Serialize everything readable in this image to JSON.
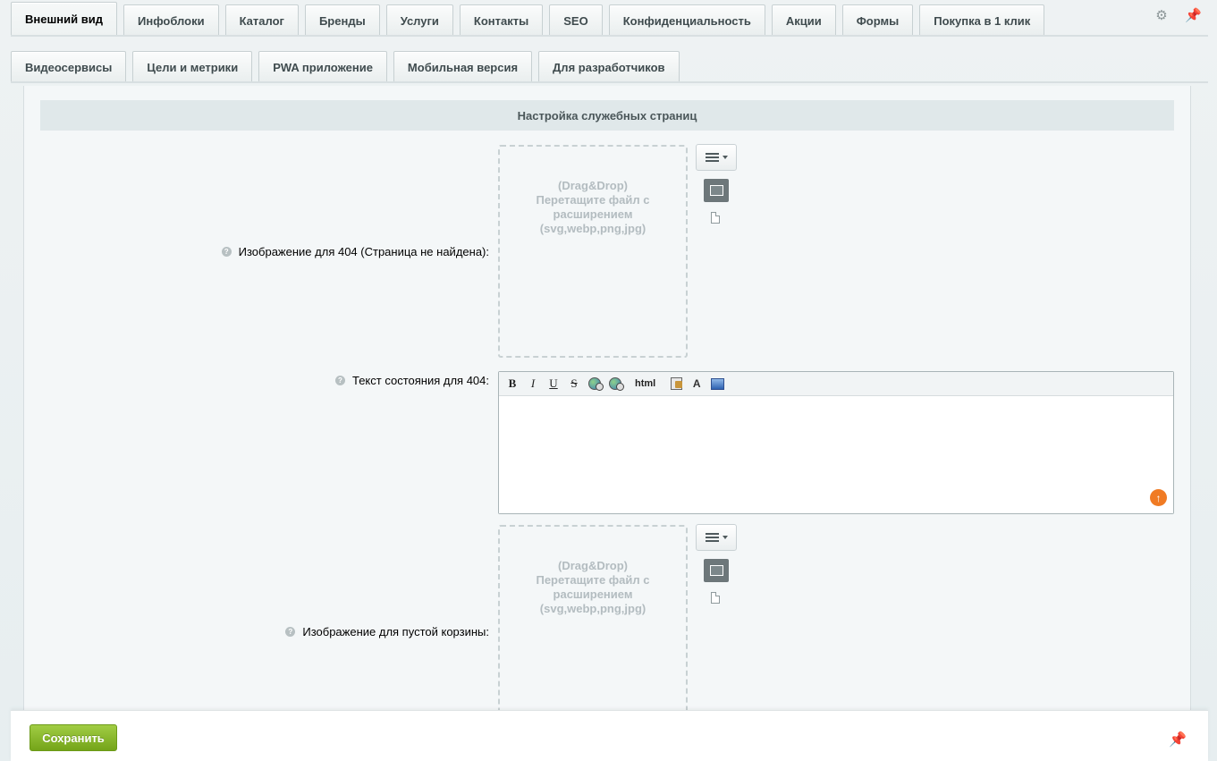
{
  "tabs_row1": [
    {
      "label": "Внешний вид",
      "active": true
    },
    {
      "label": "Инфоблоки",
      "active": false
    },
    {
      "label": "Каталог",
      "active": false
    },
    {
      "label": "Бренды",
      "active": false
    },
    {
      "label": "Услуги",
      "active": false
    },
    {
      "label": "Контакты",
      "active": false
    },
    {
      "label": "SEO",
      "active": false
    },
    {
      "label": "Конфиденциальность",
      "active": false
    },
    {
      "label": "Акции",
      "active": false
    },
    {
      "label": "Формы",
      "active": false
    },
    {
      "label": "Покупка в 1 клик",
      "active": false
    }
  ],
  "tabs_row2": [
    {
      "label": "Видеосервисы"
    },
    {
      "label": "Цели и метрики"
    },
    {
      "label": "PWA приложение"
    },
    {
      "label": "Мобильная версия"
    },
    {
      "label": "Для разработчиков"
    }
  ],
  "section": {
    "title": "Настройка служебных страниц"
  },
  "fields": {
    "image_404": {
      "label": "Изображение для 404 (Страница не найдена):",
      "dropzone_text": [
        "(Drag&Drop)",
        "Перетащите файл с",
        "расширением",
        "(svg,webp,png,jpg)"
      ]
    },
    "text_404": {
      "label": "Текст состояния для 404:",
      "value": "",
      "toolbar": {
        "bold": "B",
        "italic": "I",
        "underline": "U",
        "strike": "S",
        "html": "html"
      }
    },
    "image_empty_cart": {
      "label": "Изображение для пустой корзины:",
      "dropzone_text": [
        "(Drag&Drop)",
        "Перетащите файл с",
        "расширением",
        "(svg,webp,png,jpg)"
      ]
    }
  },
  "help_glyph": "?",
  "footer": {
    "save_label": "Сохранить"
  },
  "icons": {
    "settings": "gear-icon",
    "pin": "pin-icon"
  },
  "colors": {
    "save_button": "#86b52a",
    "scroll_up": "#f07b24",
    "section_head": "#e0e8ea"
  }
}
